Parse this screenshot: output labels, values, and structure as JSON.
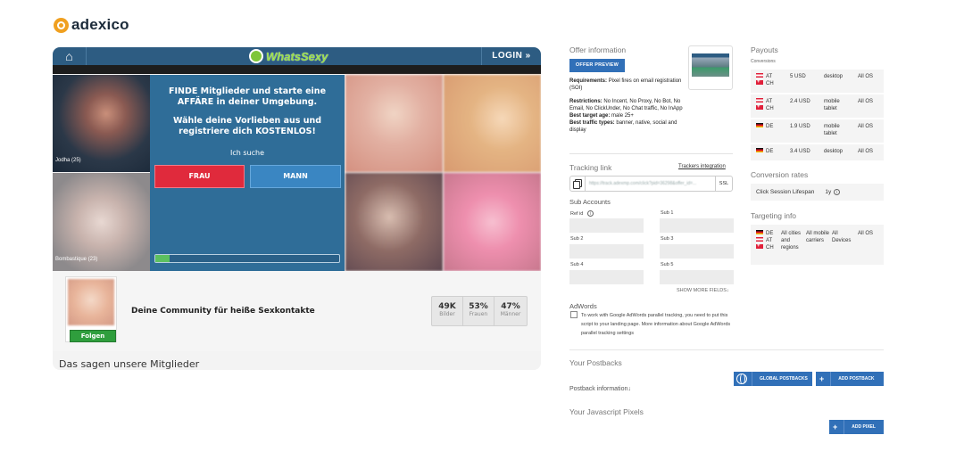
{
  "brand": {
    "name": "adexico"
  },
  "preview": {
    "site_name": "WhatsSexy",
    "login_label": "LOGIN »",
    "headline1": "FINDE Mitglieder und starte eine AFFÄRE in deiner Umgebung.",
    "headline2": "Wähle deine Vorlieben aus und registriere dich KOSTENLOS!",
    "search_label": "Ich suche",
    "btn_female": "FRAU",
    "btn_male": "MANN",
    "progress": 0.08,
    "photo_labels": [
      "Jodha (25)",
      "Bombastique (23)",
      "",
      "",
      "",
      ""
    ],
    "community_text": "Deine Community für heiße Sexkontakte",
    "follow_label": "Folgen",
    "stats": [
      {
        "value": "49K",
        "label": "Bilder"
      },
      {
        "value": "53%",
        "label": "Frauen"
      },
      {
        "value": "47%",
        "label": "Männer"
      }
    ],
    "testimonials_heading": "Das sagen unsere Mitglieder"
  },
  "offer": {
    "title": "Offer information",
    "preview_button": "OFFER PREVIEW",
    "requirements_label": "Requirements:",
    "requirements_text": "Pixel fires on email registration (SOI)",
    "restrictions_label": "Restrictions:",
    "restrictions_text": "No Incent, No Proxy, No Bot, No Email, No ClickUnder, No Chat traffic, No InApp",
    "target_age_label": "Best target age:",
    "target_age_text": "male 25+",
    "traffic_types_label": "Best traffic types:",
    "traffic_types_text": "banner, native, social and display"
  },
  "tracking": {
    "title": "Tracking link",
    "integration_link": "Trackers integration",
    "url": "https://track.adexmp.com/click?pid=36298&offer_id=...",
    "ssl_label": "SSL",
    "sub_accounts_title": "Sub Accounts",
    "fields": [
      "Ref id",
      "Sub 1",
      "Sub 2",
      "Sub 3",
      "Sub 4",
      "Sub 5"
    ],
    "show_more": "SHOW MORE FIELDS",
    "adwords_title": "AdWords",
    "adwords_text": "To work with Google AdWords parallel tracking, you need to put this script to your landing page. More information about Google AdWords parallel tracking settings"
  },
  "postbacks": {
    "title": "Your Postbacks",
    "global_button": "GLOBAL POSTBACKS",
    "add_button": "ADD POSTBACK",
    "info_label": "Postback information",
    "js_title": "Your Javascript Pixels",
    "add_pixel_button": "ADD PIXEL"
  },
  "payouts": {
    "title": "Payouts",
    "conversions_label": "Conversions",
    "rows": [
      {
        "geo": [
          "AT",
          "CH"
        ],
        "amount": "5 USD",
        "device": "desktop",
        "os": "All OS"
      },
      {
        "geo": [
          "AT",
          "CH"
        ],
        "amount": "2.4 USD",
        "device": "mobile tablet",
        "os": "All OS"
      },
      {
        "geo": [
          "DE"
        ],
        "amount": "1.9 USD",
        "device": "mobile tablet",
        "os": "All OS"
      },
      {
        "geo": [
          "DE"
        ],
        "amount": "3.4 USD",
        "device": "desktop",
        "os": "All OS"
      }
    ]
  },
  "conversion_rates": {
    "title": "Conversion rates",
    "label": "Click Session Lifespan",
    "value": "1y"
  },
  "targeting": {
    "title": "Targeting info",
    "geo": [
      "DE",
      "AT",
      "CH"
    ],
    "cities": "All cities and regions",
    "carriers": "All mobile carriers",
    "devices": "All Devices",
    "os": "All OS"
  },
  "colors": {
    "primary": "#3170b8",
    "brand_orange": "#f0a020",
    "preview_blue": "#2f6d98"
  }
}
